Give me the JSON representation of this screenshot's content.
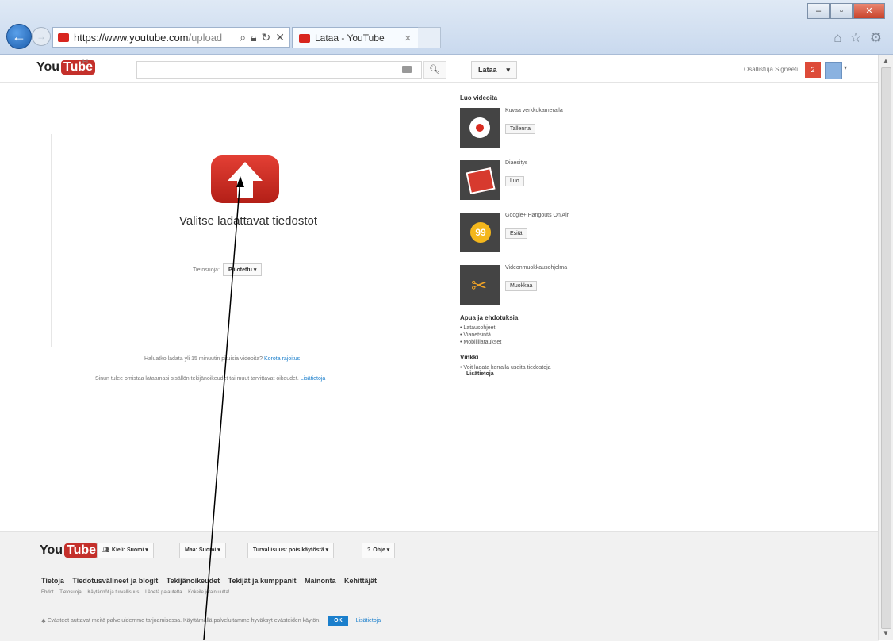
{
  "browser": {
    "url_host": "https://www.youtube.com",
    "url_path": "/upload",
    "tab_title": "Lataa - YouTube",
    "window_buttons": [
      "–",
      "▫",
      "✕"
    ]
  },
  "masthead": {
    "logo_you": "You",
    "logo_tube": "Tube",
    "country": "FI",
    "upload_label": "Lataa",
    "user_name": "Osallistuja Signeeti",
    "notifications": "2"
  },
  "upload": {
    "title": "Valitse ladattavat tiedostot",
    "privacy_label": "Tietosuoja:",
    "privacy_value": "Piilotettu",
    "long_video_text": "Haluatko ladata yli 15 minuutin pituisia videoita?",
    "long_video_link": "Korota rajoitus",
    "rights_text": "Sinun tulee omistaa lataamasi sisällön tekijänoikeudet tai muut tarvittavat oikeudet.",
    "rights_link": "Lisätietoja"
  },
  "sidebar": {
    "create_heading": "Luo videoita",
    "items": [
      {
        "title": "Kuvaa verkkokameralla",
        "button": "Tallenna"
      },
      {
        "title": "Diaesitys",
        "button": "Luo"
      },
      {
        "title": "Google+ Hangouts On Air",
        "button": "Esitä"
      },
      {
        "title": "Videonmuokkausohjelma",
        "button": "Muokkaa"
      }
    ],
    "help_heading": "Apua ja ehdotuksia",
    "help_links": [
      "Latausohjeet",
      "Vianetsintä",
      "Mobiililataukset"
    ],
    "tips_heading": "Vinkki",
    "tip_text": "Voit ladata kerralla useita tiedostoja",
    "tip_more": "Lisätietoja"
  },
  "footer": {
    "language": "Kieli: Suomi",
    "country": "Maa: Suomi",
    "safety": "Turvallisuus: pois käytöstä",
    "help": "Ohje",
    "links_primary": [
      "Tietoja",
      "Tiedotusvälineet ja blogit",
      "Tekijänoikeudet",
      "Tekijät ja kumppanit",
      "Mainonta",
      "Kehittäjät"
    ],
    "links_secondary": [
      "Ehdot",
      "Tietosuoja",
      "Käytännöt ja turvallisuus",
      "Lähetä palautetta",
      "Kokeile jotain uutta!"
    ],
    "cookie_text": "Evästeet auttavat meitä palveluidemme tarjoamisessa. Käyttämällä palveluitamme hyväksyt evästeiden käytön.",
    "cookie_ok": "OK",
    "cookie_more": "Lisätietoja"
  }
}
